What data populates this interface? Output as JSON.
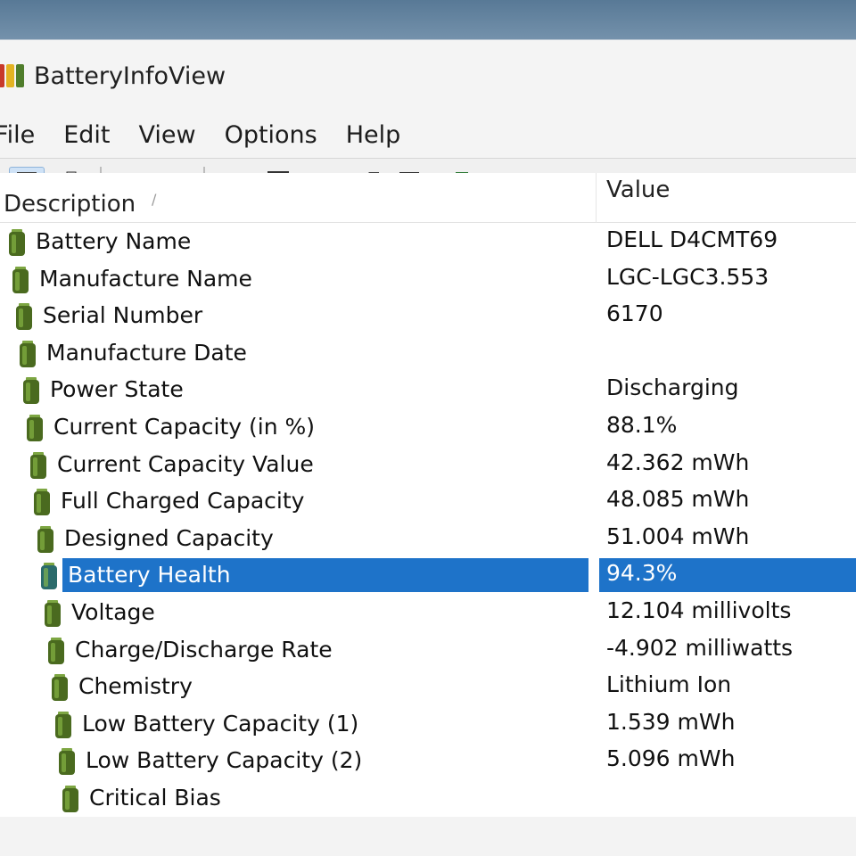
{
  "window": {
    "title": "BatteryInfoView"
  },
  "menu": [
    "File",
    "Edit",
    "View",
    "Options",
    "Help"
  ],
  "toolbar": [
    {
      "name": "properties-icon",
      "active": true
    },
    {
      "name": "clipboard-icon"
    },
    {
      "sep": true
    },
    {
      "name": "window-icon"
    },
    {
      "name": "delete-icon"
    },
    {
      "sep": true
    },
    {
      "name": "save-icon"
    },
    {
      "name": "refresh-icon"
    },
    {
      "name": "copy-icon"
    },
    {
      "name": "open-properties-icon"
    },
    {
      "name": "find-icon"
    },
    {
      "name": "exit-icon"
    }
  ],
  "columns": {
    "description": "Description",
    "sort_mark": "/",
    "value": "Value"
  },
  "rows": [
    {
      "name": "Battery Name",
      "value": "DELL D4CMT69"
    },
    {
      "name": "Manufacture Name",
      "value": "LGC-LGC3.553"
    },
    {
      "name": "Serial Number",
      "value": "6170"
    },
    {
      "name": "Manufacture Date",
      "value": ""
    },
    {
      "name": "Power State",
      "value": "Discharging"
    },
    {
      "name": "Current Capacity (in %)",
      "value": "88.1%"
    },
    {
      "name": "Current Capacity Value",
      "value": "42.362 mWh"
    },
    {
      "name": "Full Charged Capacity",
      "value": "48.085 mWh"
    },
    {
      "name": "Designed Capacity",
      "value": "51.004 mWh"
    },
    {
      "name": "Battery Health",
      "value": "94.3%",
      "selected": true
    },
    {
      "name": "Voltage",
      "value": "12.104 millivolts"
    },
    {
      "name": "Charge/Discharge Rate",
      "value": "-4.902 milliwatts"
    },
    {
      "name": "Chemistry",
      "value": "Lithium Ion"
    },
    {
      "name": "Low Battery Capacity (1)",
      "value": "1.539 mWh"
    },
    {
      "name": "Low Battery Capacity (2)",
      "value": "5.096 mWh"
    },
    {
      "name": "Critical Bias",
      "value": ""
    }
  ],
  "colors": {
    "selection": "#1e73c9",
    "battery_icon": "#4a6a1f"
  }
}
